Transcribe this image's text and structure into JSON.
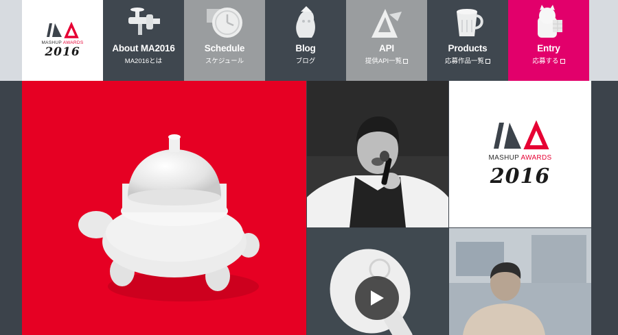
{
  "brand": {
    "mark_letters": "MA",
    "word_mashup": "MASHUP",
    "word_awards": "AWARDS",
    "year": "2016"
  },
  "nav": [
    {
      "label": "About MA2016",
      "sub": "MA2016とは",
      "icon": "faucet-icon",
      "external": false
    },
    {
      "label": "Schedule",
      "sub": "スケジュール",
      "icon": "clock-icon",
      "external": false
    },
    {
      "label": "Blog",
      "sub": "ブログ",
      "icon": "figurine-icon",
      "external": false
    },
    {
      "label": "API",
      "sub": "提供API一覧",
      "icon": "triangle-sculpture-icon",
      "external": true
    },
    {
      "label": "Products",
      "sub": "応募作品一覧",
      "icon": "mug-icon",
      "external": true
    },
    {
      "label": "Entry",
      "sub": "応募する",
      "icon": "lucky-cat-icon",
      "external": true
    }
  ],
  "tiles": {
    "hero": {
      "icon": "tortoise-sculpture-icon"
    },
    "speaker": {
      "icon": "speaker-photo-icon"
    },
    "video": {
      "icon": "play-icon"
    },
    "audience": {
      "icon": "audience-photo-icon"
    }
  },
  "colors": {
    "accent_red": "#e60023",
    "entry_pink": "#e2006b",
    "nav_dark": "#3f474f",
    "nav_grey": "#9a9d9f"
  }
}
